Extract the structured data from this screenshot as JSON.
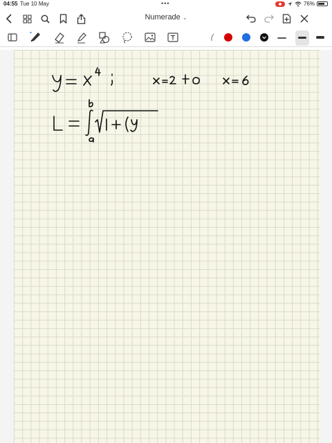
{
  "status_bar": {
    "time": "04:55",
    "date": "Tue 10 May",
    "battery": "76%",
    "battery_level": 0.76
  },
  "nav": {
    "title": "Numerade",
    "icons": [
      "back-chevron-icon",
      "grid-icon",
      "search-icon",
      "bookmark-icon",
      "share-icon",
      "undo-icon",
      "redo-icon",
      "add-page-icon",
      "close-icon"
    ]
  },
  "tools": {
    "icons": [
      "sidebar-icon",
      "pen-icon",
      "eraser-icon",
      "highlighter-icon",
      "shapes-icon",
      "lasso-icon",
      "image-icon",
      "text-box-icon",
      "more-tools-icon"
    ],
    "colors": {
      "red": "#d50000",
      "blue": "#1e6fe0",
      "black": "#111111"
    }
  },
  "paper": {
    "background": "#f8f6e6",
    "grid_color": "#d6dbd0"
  }
}
